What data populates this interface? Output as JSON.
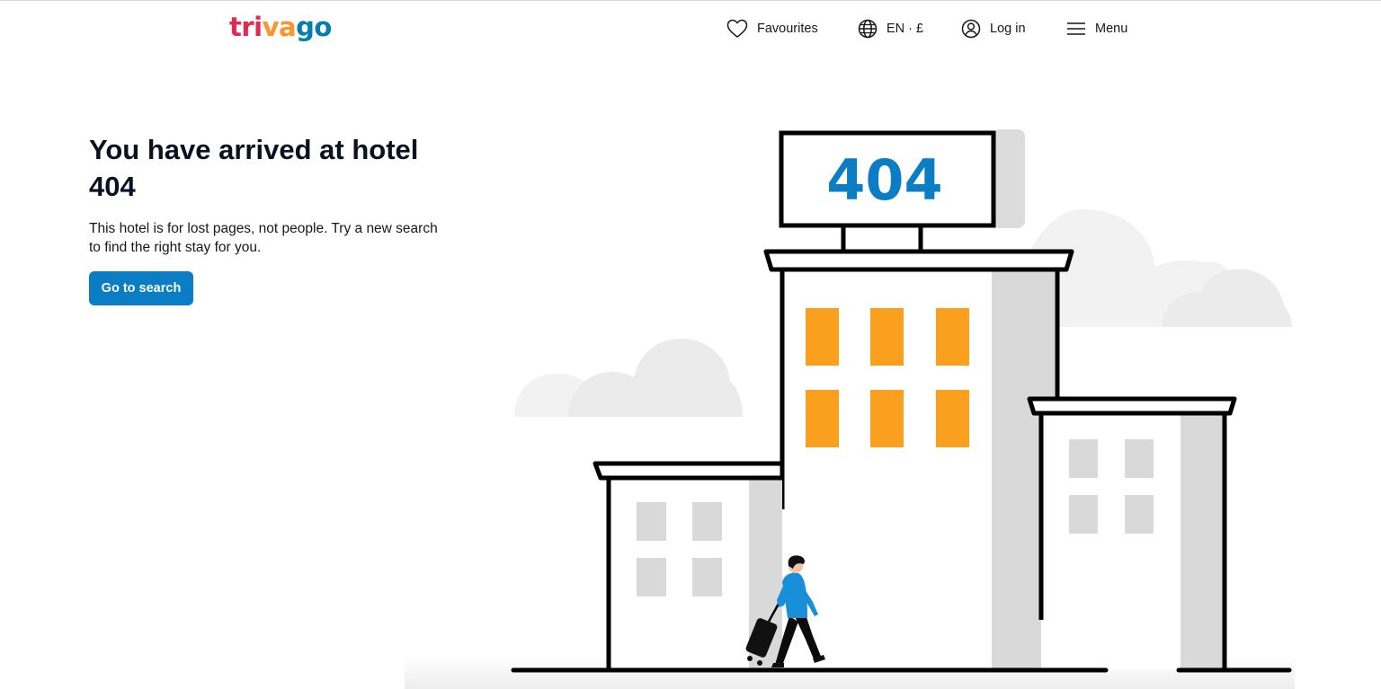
{
  "header": {
    "logo": {
      "part1": "tri",
      "part2": "va",
      "part3": "go"
    },
    "nav": {
      "favourites": "Favourites",
      "language": "EN · £",
      "login": "Log in",
      "menu": "Menu"
    }
  },
  "main": {
    "title": "You have arrived at hotel 404",
    "description": "This hotel is for lost pages, not people. Try a new search to find the right stay for you.",
    "cta_label": "Go to search"
  },
  "illustration": {
    "sign_text": "404"
  },
  "colors": {
    "brand_red": "#e32851",
    "brand_orange": "#ff932c",
    "brand_blue": "#007fad",
    "button_blue": "#0a7dc5",
    "window_orange": "#fb9f1e",
    "sign_blue": "#0a7dc5"
  },
  "icons": {
    "favourites": "heart-icon",
    "language": "globe-icon",
    "login": "user-circle-icon",
    "menu": "hamburger-menu-icon"
  }
}
